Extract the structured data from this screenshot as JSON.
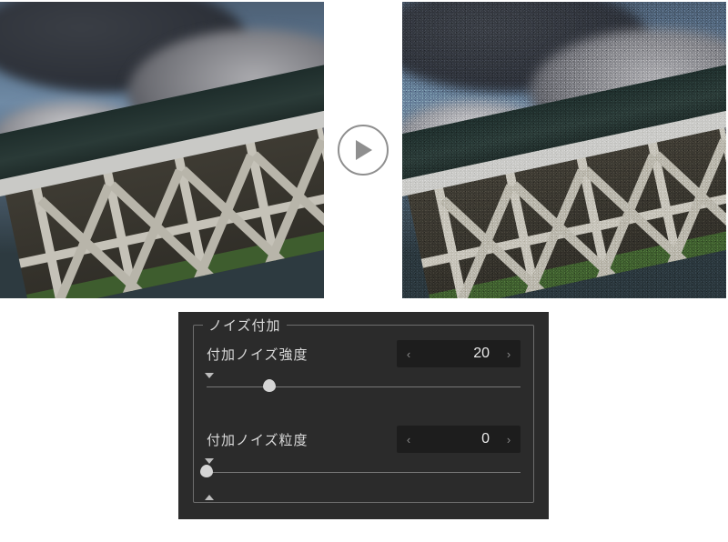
{
  "comparison": {
    "arrow_icon": "play-icon"
  },
  "panel": {
    "group_title": "ノイズ付加",
    "params": [
      {
        "label": "付加ノイズ強度",
        "value": "20",
        "thumb_pct": 20
      },
      {
        "label": "付加ノイズ粒度",
        "value": "0",
        "thumb_pct": 0
      }
    ],
    "stepper_decrease_glyph": "‹",
    "stepper_increase_glyph": "›"
  }
}
